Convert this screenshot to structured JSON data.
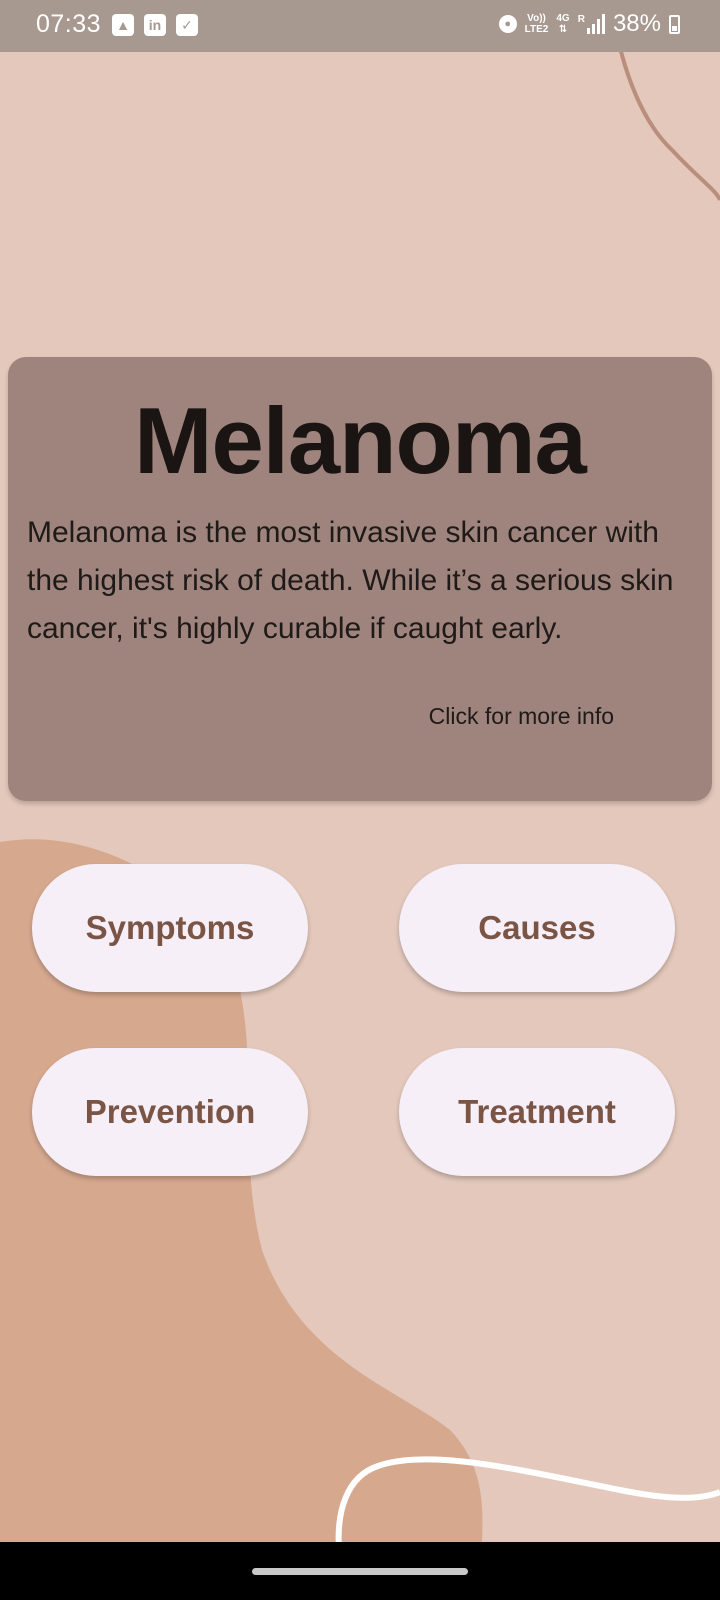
{
  "status_bar": {
    "time": "07:33",
    "notification_icons": [
      "gallery-icon",
      "linkedin-icon",
      "check-icon"
    ],
    "volte_label": "Vo))",
    "lte_label": "LTE2",
    "network_label": "4G",
    "roaming_label": "R",
    "battery_percent": "38%"
  },
  "card": {
    "title": "Melanoma",
    "description": "Melanoma is the most invasive skin cancer with the highest risk of death. While it’s a serious skin cancer, it's highly curable if caught early.",
    "link": "Click for more info"
  },
  "buttons": {
    "symptoms": "Symptoms",
    "causes": "Causes",
    "prevention": "Prevention",
    "treatment": "Treatment"
  },
  "colors": {
    "background": "#e3c8bb",
    "blob": "#d6a88e",
    "card": "#9e847d",
    "button_bg": "#f6eff8",
    "button_text": "#7a5545"
  }
}
